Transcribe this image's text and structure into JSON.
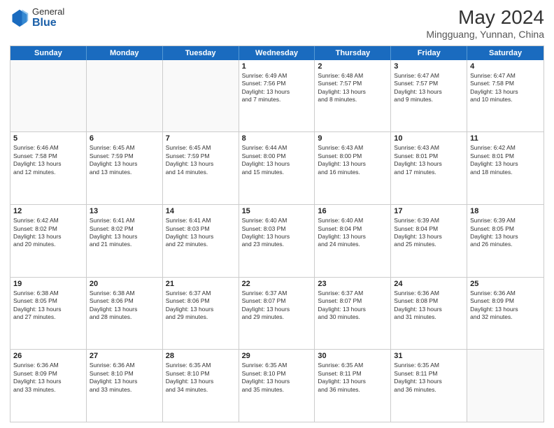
{
  "header": {
    "logo_general": "General",
    "logo_blue": "Blue",
    "title": "May 2024",
    "subtitle": "Mingguang, Yunnan, China"
  },
  "days_of_week": [
    "Sunday",
    "Monday",
    "Tuesday",
    "Wednesday",
    "Thursday",
    "Friday",
    "Saturday"
  ],
  "weeks": [
    [
      {
        "day": "",
        "info": ""
      },
      {
        "day": "",
        "info": ""
      },
      {
        "day": "",
        "info": ""
      },
      {
        "day": "1",
        "info": "Sunrise: 6:49 AM\nSunset: 7:56 PM\nDaylight: 13 hours\nand 7 minutes."
      },
      {
        "day": "2",
        "info": "Sunrise: 6:48 AM\nSunset: 7:57 PM\nDaylight: 13 hours\nand 8 minutes."
      },
      {
        "day": "3",
        "info": "Sunrise: 6:47 AM\nSunset: 7:57 PM\nDaylight: 13 hours\nand 9 minutes."
      },
      {
        "day": "4",
        "info": "Sunrise: 6:47 AM\nSunset: 7:58 PM\nDaylight: 13 hours\nand 10 minutes."
      }
    ],
    [
      {
        "day": "5",
        "info": "Sunrise: 6:46 AM\nSunset: 7:58 PM\nDaylight: 13 hours\nand 12 minutes."
      },
      {
        "day": "6",
        "info": "Sunrise: 6:45 AM\nSunset: 7:59 PM\nDaylight: 13 hours\nand 13 minutes."
      },
      {
        "day": "7",
        "info": "Sunrise: 6:45 AM\nSunset: 7:59 PM\nDaylight: 13 hours\nand 14 minutes."
      },
      {
        "day": "8",
        "info": "Sunrise: 6:44 AM\nSunset: 8:00 PM\nDaylight: 13 hours\nand 15 minutes."
      },
      {
        "day": "9",
        "info": "Sunrise: 6:43 AM\nSunset: 8:00 PM\nDaylight: 13 hours\nand 16 minutes."
      },
      {
        "day": "10",
        "info": "Sunrise: 6:43 AM\nSunset: 8:01 PM\nDaylight: 13 hours\nand 17 minutes."
      },
      {
        "day": "11",
        "info": "Sunrise: 6:42 AM\nSunset: 8:01 PM\nDaylight: 13 hours\nand 18 minutes."
      }
    ],
    [
      {
        "day": "12",
        "info": "Sunrise: 6:42 AM\nSunset: 8:02 PM\nDaylight: 13 hours\nand 20 minutes."
      },
      {
        "day": "13",
        "info": "Sunrise: 6:41 AM\nSunset: 8:02 PM\nDaylight: 13 hours\nand 21 minutes."
      },
      {
        "day": "14",
        "info": "Sunrise: 6:41 AM\nSunset: 8:03 PM\nDaylight: 13 hours\nand 22 minutes."
      },
      {
        "day": "15",
        "info": "Sunrise: 6:40 AM\nSunset: 8:03 PM\nDaylight: 13 hours\nand 23 minutes."
      },
      {
        "day": "16",
        "info": "Sunrise: 6:40 AM\nSunset: 8:04 PM\nDaylight: 13 hours\nand 24 minutes."
      },
      {
        "day": "17",
        "info": "Sunrise: 6:39 AM\nSunset: 8:04 PM\nDaylight: 13 hours\nand 25 minutes."
      },
      {
        "day": "18",
        "info": "Sunrise: 6:39 AM\nSunset: 8:05 PM\nDaylight: 13 hours\nand 26 minutes."
      }
    ],
    [
      {
        "day": "19",
        "info": "Sunrise: 6:38 AM\nSunset: 8:05 PM\nDaylight: 13 hours\nand 27 minutes."
      },
      {
        "day": "20",
        "info": "Sunrise: 6:38 AM\nSunset: 8:06 PM\nDaylight: 13 hours\nand 28 minutes."
      },
      {
        "day": "21",
        "info": "Sunrise: 6:37 AM\nSunset: 8:06 PM\nDaylight: 13 hours\nand 29 minutes."
      },
      {
        "day": "22",
        "info": "Sunrise: 6:37 AM\nSunset: 8:07 PM\nDaylight: 13 hours\nand 29 minutes."
      },
      {
        "day": "23",
        "info": "Sunrise: 6:37 AM\nSunset: 8:07 PM\nDaylight: 13 hours\nand 30 minutes."
      },
      {
        "day": "24",
        "info": "Sunrise: 6:36 AM\nSunset: 8:08 PM\nDaylight: 13 hours\nand 31 minutes."
      },
      {
        "day": "25",
        "info": "Sunrise: 6:36 AM\nSunset: 8:09 PM\nDaylight: 13 hours\nand 32 minutes."
      }
    ],
    [
      {
        "day": "26",
        "info": "Sunrise: 6:36 AM\nSunset: 8:09 PM\nDaylight: 13 hours\nand 33 minutes."
      },
      {
        "day": "27",
        "info": "Sunrise: 6:36 AM\nSunset: 8:10 PM\nDaylight: 13 hours\nand 33 minutes."
      },
      {
        "day": "28",
        "info": "Sunrise: 6:35 AM\nSunset: 8:10 PM\nDaylight: 13 hours\nand 34 minutes."
      },
      {
        "day": "29",
        "info": "Sunrise: 6:35 AM\nSunset: 8:10 PM\nDaylight: 13 hours\nand 35 minutes."
      },
      {
        "day": "30",
        "info": "Sunrise: 6:35 AM\nSunset: 8:11 PM\nDaylight: 13 hours\nand 36 minutes."
      },
      {
        "day": "31",
        "info": "Sunrise: 6:35 AM\nSunset: 8:11 PM\nDaylight: 13 hours\nand 36 minutes."
      },
      {
        "day": "",
        "info": ""
      }
    ]
  ]
}
